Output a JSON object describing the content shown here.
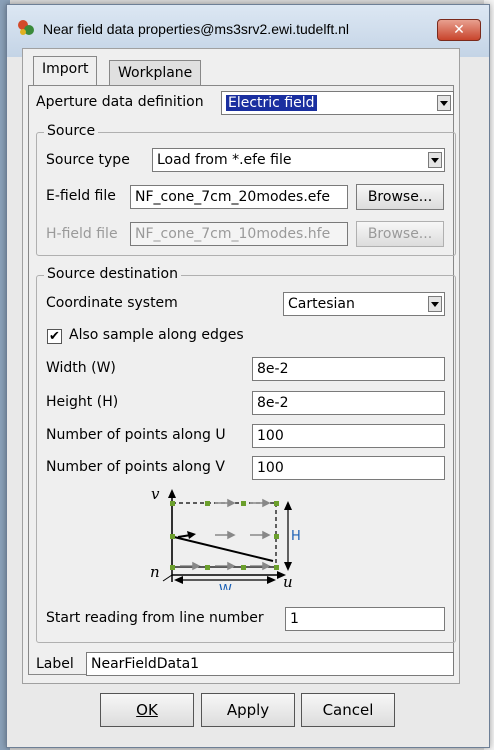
{
  "window": {
    "title": "Near field data properties@ms3srv2.ewi.tudelft.nl",
    "close": "✕"
  },
  "tabs": [
    {
      "label": "Import"
    },
    {
      "label": "Workplane"
    }
  ],
  "aperture": {
    "label": "Aperture data definition",
    "value": "Electric field"
  },
  "source": {
    "title": "Source",
    "type_label": "Source type",
    "type_value": "Load from *.efe file",
    "efield_label": "E-field file",
    "efield_value": "NF_cone_7cm_20modes.efe",
    "hfield_label": "H-field file",
    "hfield_value": "NF_cone_7cm_10modes.hfe",
    "browse": "Browse..."
  },
  "dest": {
    "title": "Source destination",
    "coord_label": "Coordinate system",
    "coord_value": "Cartesian",
    "edges_label": "Also sample along edges",
    "edges_checked": "✔",
    "width_label": "Width (W)",
    "width_value": "8e-2",
    "height_label": "Height (H)",
    "height_value": "8e-2",
    "npu_label": "Number of points along U",
    "npu_value": "100",
    "npv_label": "Number of points along V",
    "npv_value": "100",
    "diagram": {
      "v": "v",
      "n": "n",
      "u": "u",
      "H": "H",
      "W": "W"
    },
    "start_label": "Start reading from line number",
    "start_value": "1"
  },
  "label": {
    "label": "Label",
    "value": "NearFieldData1"
  },
  "footer": {
    "ok": "OK",
    "apply": "Apply",
    "cancel": "Cancel"
  }
}
